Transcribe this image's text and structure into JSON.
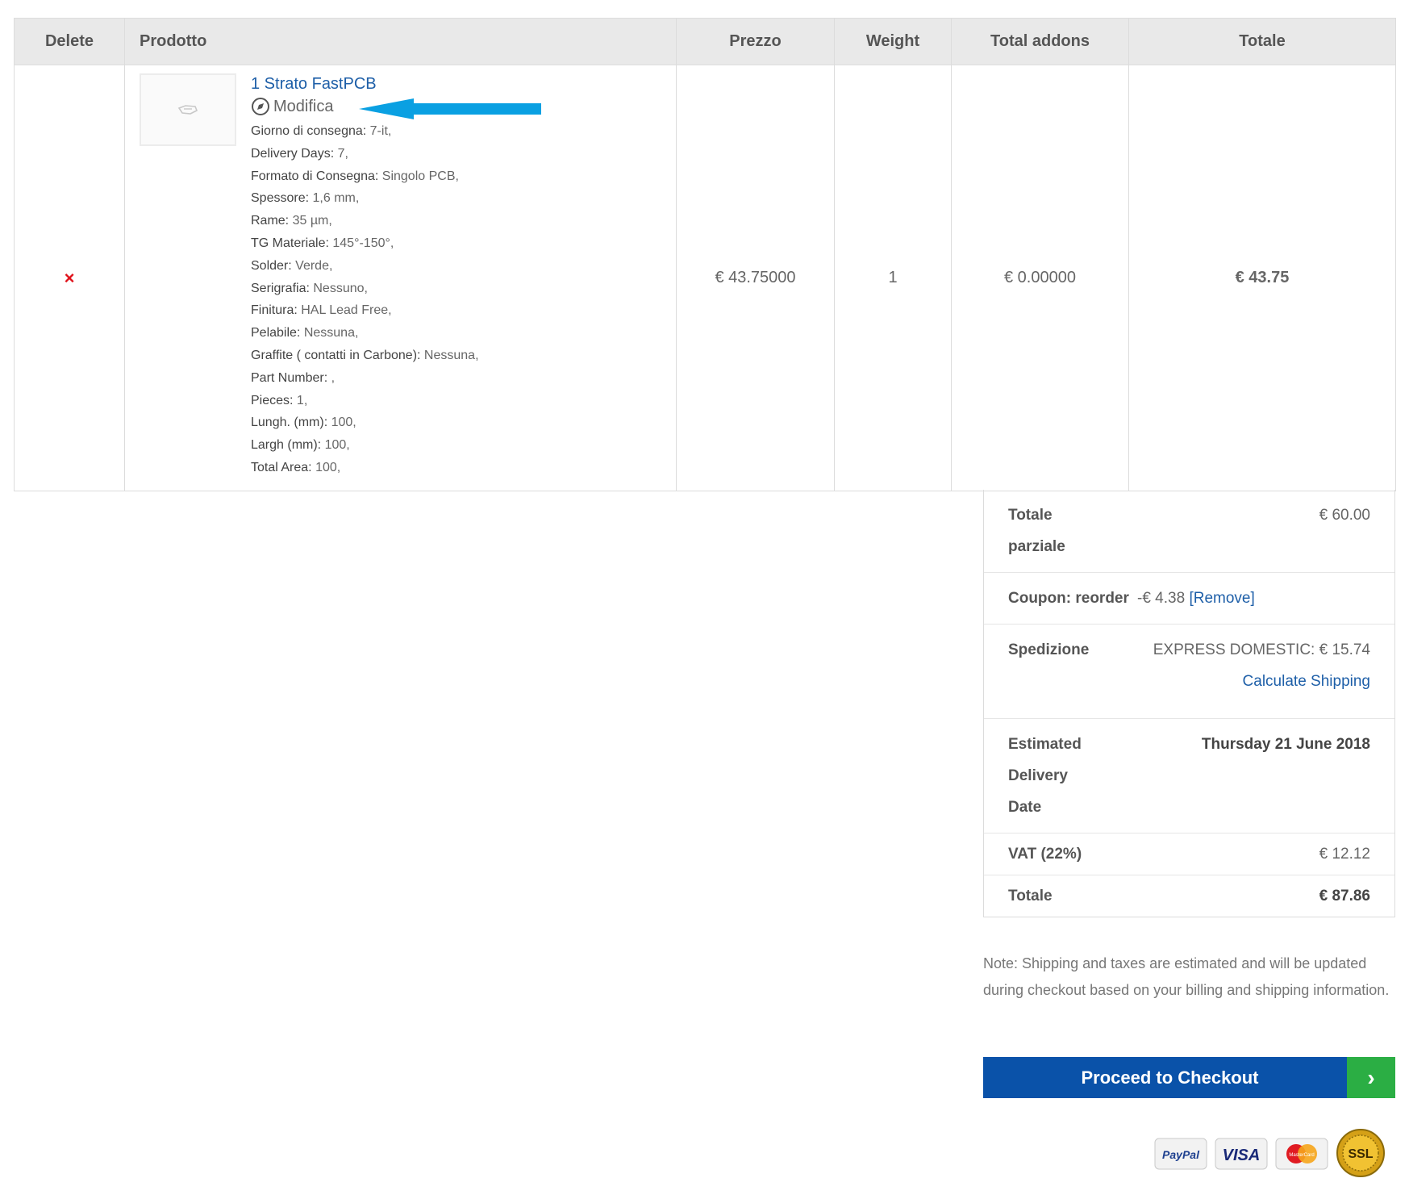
{
  "table": {
    "headers": {
      "delete": "Delete",
      "product": "Prodotto",
      "price": "Prezzo",
      "weight": "Weight",
      "addons": "Total addons",
      "total": "Totale"
    },
    "row": {
      "delete_symbol": "×",
      "product_name": "1 Strato FastPCB",
      "edit_label": "Modifica",
      "attributes": [
        {
          "k": "Giorno di consegna:",
          "v": "7-it,"
        },
        {
          "k": "Delivery Days:",
          "v": "7,"
        },
        {
          "k": "Formato di Consegna:",
          "v": "Singolo PCB,"
        },
        {
          "k": "Spessore:",
          "v": "1,6 mm,"
        },
        {
          "k": "Rame:",
          "v": "35 µm,"
        },
        {
          "k": "TG Materiale:",
          "v": "145°-150°,"
        },
        {
          "k": "Solder:",
          "v": "Verde,"
        },
        {
          "k": "Serigrafia:",
          "v": "Nessuno,"
        },
        {
          "k": "Finitura:",
          "v": "HAL Lead Free,"
        },
        {
          "k": "Pelabile:",
          "v": "Nessuna,"
        },
        {
          "k": "Graffite ( contatti in Carbone):",
          "v": "Nessuna,"
        },
        {
          "k": "Part Number:",
          "v": ","
        },
        {
          "k": "Pieces:",
          "v": "1,"
        },
        {
          "k": "Lungh. (mm):",
          "v": "100,"
        },
        {
          "k": "Largh (mm):",
          "v": "100,"
        },
        {
          "k": "Total Area:",
          "v": "100,"
        }
      ],
      "price": "€ 43.75000",
      "weight": "1",
      "addons": "€ 0.00000",
      "total": "€ 43.75"
    }
  },
  "totals": {
    "subtotal": {
      "label": "Totale parziale",
      "value": "€ 60.00"
    },
    "coupon": {
      "label": "Coupon: reorder",
      "value": "-€ 4.38",
      "remove": "[Remove]"
    },
    "shipping": {
      "label": "Spedizione",
      "value": "EXPRESS DOMESTIC: € 15.74",
      "calc_link": "Calculate Shipping"
    },
    "delivery": {
      "label": "Estimated Delivery Date",
      "value": "Thursday 21 June 2018"
    },
    "vat": {
      "label": "VAT (22%)",
      "value": "€ 12.12"
    },
    "grand": {
      "label": "Totale",
      "value": "€ 87.86"
    }
  },
  "note": "Note: Shipping and taxes are estimated and will be updated during checkout based on your billing and shipping information.",
  "checkout": {
    "label": "Proceed to Checkout",
    "chevron": "›"
  },
  "payments": {
    "paypal": "PayPal",
    "visa": "VISA",
    "mastercard": "MasterCard",
    "ssl": "SSL"
  },
  "colors": {
    "accent_blue": "#0a52a9",
    "link_blue": "#1e5fa8",
    "green": "#2bae44",
    "delete_red": "#e0121b",
    "arrow_blue": "#0aa0e2"
  }
}
